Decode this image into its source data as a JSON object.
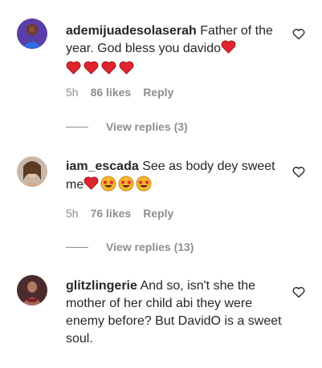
{
  "comments": [
    {
      "username": "ademijuadesolaserah",
      "text": "Father of the year. God bless you davido",
      "time": "5h",
      "likes": "86 likes",
      "reply": "Reply",
      "view_replies": "View replies (3)"
    },
    {
      "username": "iam_escada",
      "text": "See as body dey sweet me",
      "time": "5h",
      "likes": "76 likes",
      "reply": "Reply",
      "view_replies": "View replies (13)"
    },
    {
      "username": "glitzlingerie",
      "text": "And so, isn't she the mother of her child abi they were enemy before? But DavidO is a sweet soul."
    }
  ],
  "colors": {
    "text": "#262626",
    "muted": "#8e8e8e",
    "heart_emoji": "#e0252f",
    "grin_emoji": "#f5b82e"
  },
  "icons": [
    "heart-emoji",
    "star-struck-emoji",
    "heart-outline-icon"
  ]
}
